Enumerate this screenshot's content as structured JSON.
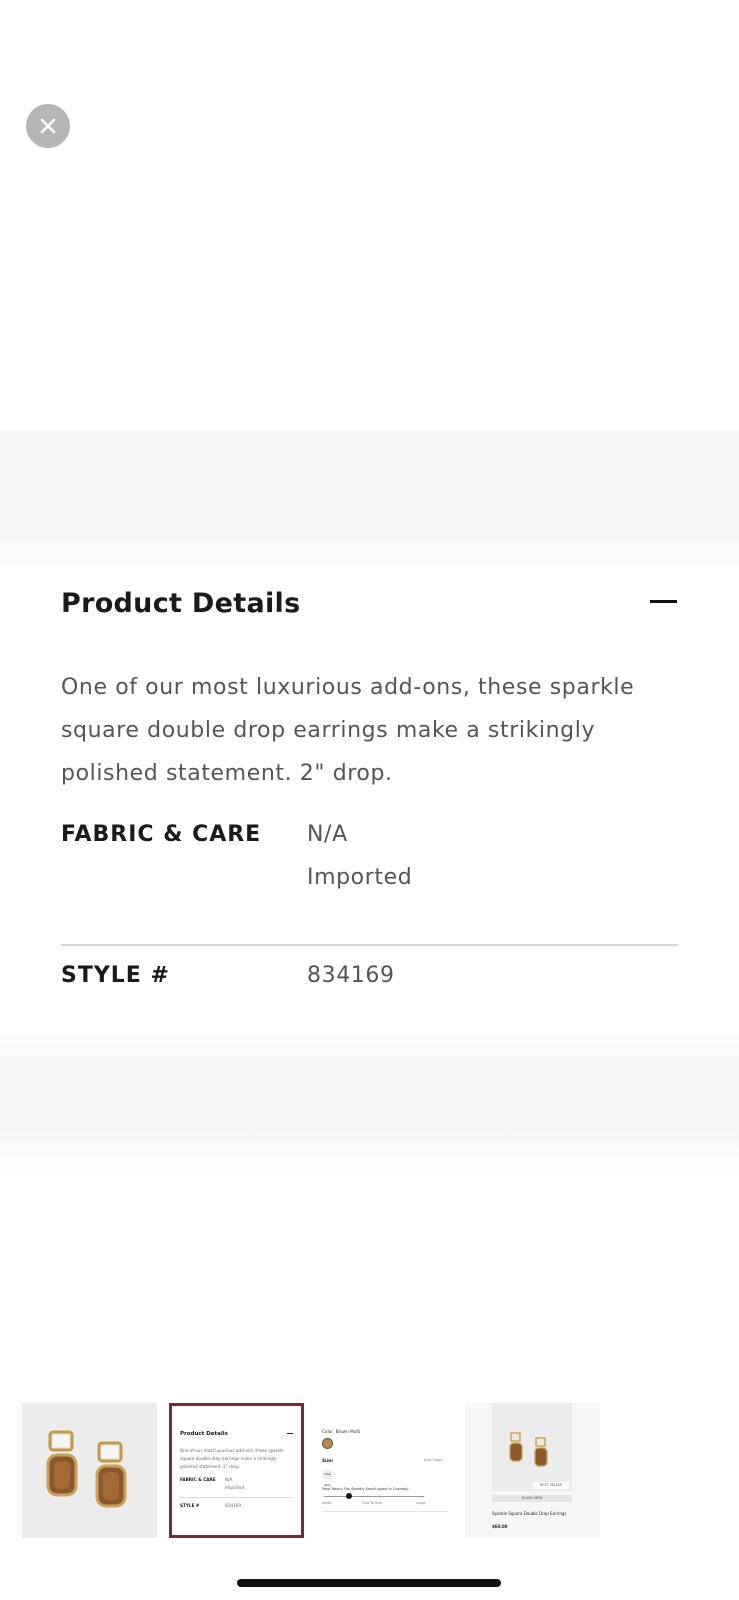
{
  "details": {
    "title": "Product Details",
    "description": "One of our most luxurious add-ons, these sparkle square double drop earrings make a strikingly polished statement. 2\" drop.",
    "fabric_label": "FABRIC & CARE",
    "fabric_lines": [
      "N/A",
      "Imported"
    ],
    "style_label": "STYLE #",
    "style_value": "834169"
  },
  "thumbnails": {
    "thumb2": {
      "title": "Product Details",
      "text": "One of our most luxurious add-ons, these sparkle square double drop earrings make a strikingly polished statement. 2\" drop.",
      "fabric_label": "FABRIC & CARE",
      "fabric_value_1": "N/A",
      "fabric_value_2": "Imported",
      "style_label": "STYLE #",
      "style_value": "834169"
    },
    "thumb3": {
      "color": "Color: Brown Multi",
      "size": "Size:",
      "size_chart": "Size Chart",
      "size_option": "One Size",
      "fit_note": "Most Reach Fits Slightly Small (sized in Cosmos)",
      "scale": [
        "Small",
        "True To Size",
        "Large"
      ]
    },
    "thumb4": {
      "badge": "BEST SELLER",
      "quick_view": "QUICK VIEW",
      "name": "Sparkle Square Double Drop Earrings",
      "price": "$60.00"
    }
  }
}
